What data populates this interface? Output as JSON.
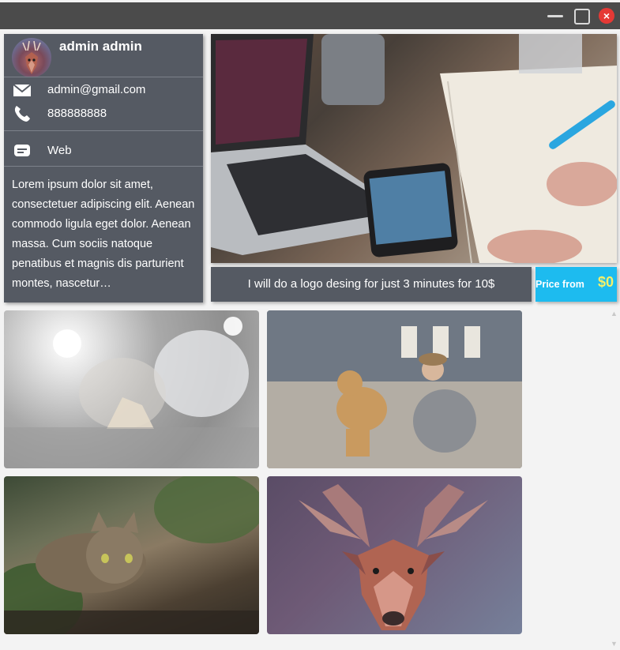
{
  "window": {
    "controls": {
      "minimize": "minimize-icon",
      "maximize": "maximize-icon",
      "close": "close-icon",
      "close_symbol": "×"
    }
  },
  "profile": {
    "name": "admin admin",
    "email": "admin@gmail.com",
    "phone": "888888888",
    "website": "Web",
    "description": "Lorem ipsum dolor sit amet, consectetuer adipiscing elit. Aenean commodo ligula eget dolor. Aenean massa. Cum sociis natoque penatibus et magnis dis parturient montes, nascetur…",
    "icons": {
      "email": "email-icon",
      "phone": "phone-icon",
      "web": "chat-icon"
    }
  },
  "offer": {
    "caption": "I will do a logo desing for just 3 minutes for 10$",
    "price_label": "Price from",
    "price_value": "$0"
  },
  "gallery": [
    {
      "subject": "dancer"
    },
    {
      "subject": "dog"
    },
    {
      "subject": "cat"
    },
    {
      "subject": "deer"
    }
  ],
  "colors": {
    "titlebar": "#4b4b4b",
    "panel": "#555a63",
    "accent": "#1dbbef",
    "price_value": "#f4f06a",
    "close": "#e53935"
  }
}
